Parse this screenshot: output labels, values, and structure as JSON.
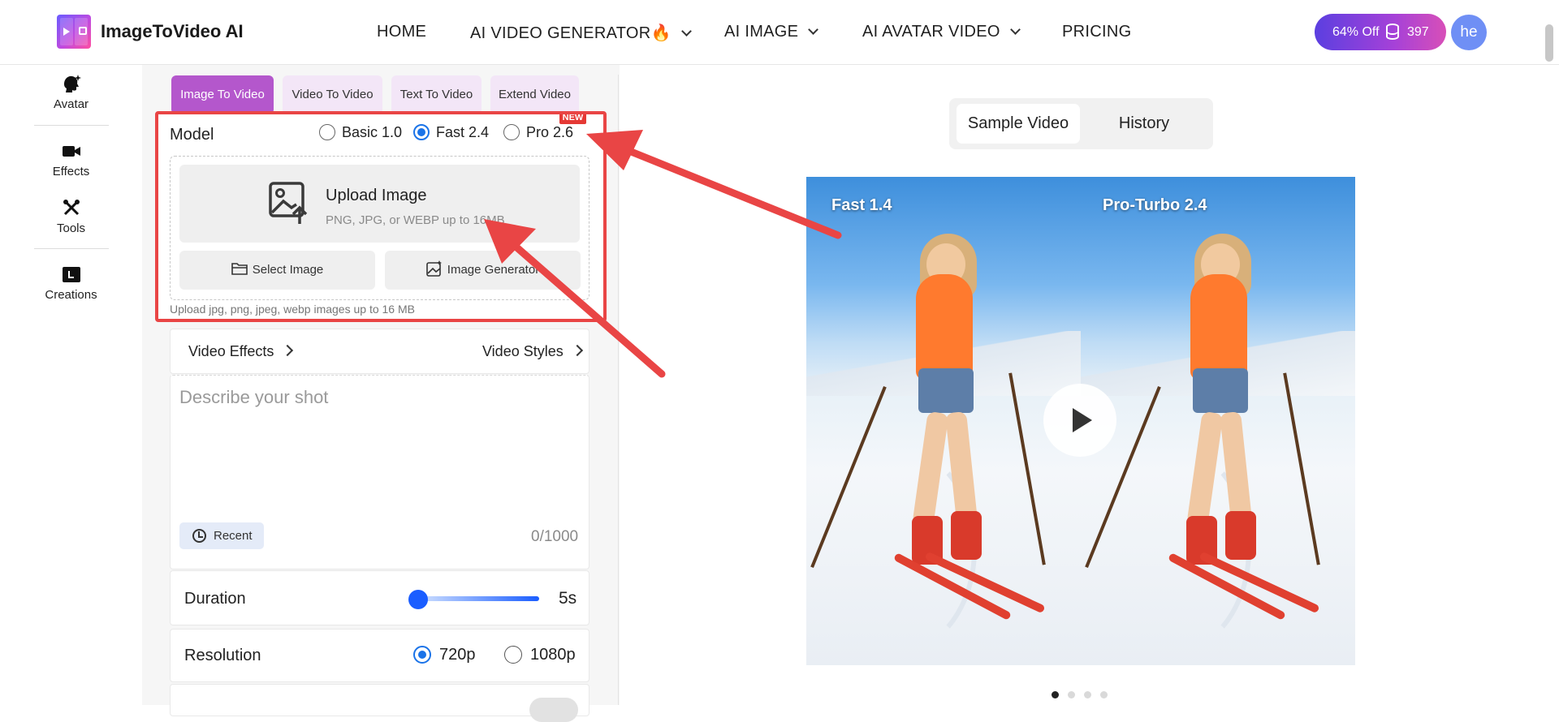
{
  "header": {
    "brand": "ImageToVideo AI",
    "nav": [
      {
        "label": "HOME"
      },
      {
        "label": "AI VIDEO GENERATOR🔥"
      },
      {
        "label": "AI IMAGE"
      },
      {
        "label": "AI AVATAR VIDEO"
      },
      {
        "label": "PRICING"
      }
    ],
    "promo_label": "64% Off",
    "credits": "397",
    "avatar_initials": "he"
  },
  "sidebar": {
    "items": [
      {
        "label": "Avatar",
        "icon": "avatar-icon"
      },
      {
        "label": "Effects",
        "icon": "video-camera-icon"
      },
      {
        "label": "Tools",
        "icon": "tools-icon"
      },
      {
        "label": "Creations",
        "icon": "creations-icon"
      }
    ]
  },
  "tabs": [
    {
      "label": "Image To Video",
      "active": true
    },
    {
      "label": "Video To Video"
    },
    {
      "label": "Text To Video"
    },
    {
      "label": "Extend Video"
    }
  ],
  "model": {
    "label": "Model",
    "options": [
      {
        "label": "Basic 1.0"
      },
      {
        "label": "Fast 2.4",
        "selected": true
      },
      {
        "label": "Pro 2.6"
      }
    ],
    "badge": "NEW"
  },
  "upload": {
    "title": "Upload Image",
    "subtitle": "PNG, JPG, or WEBP up to 16MB",
    "select_button": "Select Image",
    "generator_button": "Image Generator",
    "note": "Upload jpg, png, jpeg, webp images up to 16 MB"
  },
  "effects": {
    "left_label": "Video Effects",
    "right_label": "Video Styles"
  },
  "prompt": {
    "placeholder": "Describe your shot",
    "recent_label": "Recent",
    "counter": "0/1000"
  },
  "duration": {
    "label": "Duration",
    "value": "5s",
    "slider_fraction": 0
  },
  "resolution": {
    "label": "Resolution",
    "options": [
      {
        "label": "720p",
        "selected": true
      },
      {
        "label": "1080p"
      }
    ]
  },
  "preview": {
    "tabs": [
      {
        "label": "Sample Video",
        "active": true
      },
      {
        "label": "History"
      }
    ],
    "left_caption": "Fast 1.4",
    "right_caption": "Pro-Turbo 2.4",
    "carousel_index": 1,
    "carousel_count": 4
  },
  "colors": {
    "accent_purple": "#b457cc",
    "radio_blue": "#1a73e8",
    "annotation_red": "#e94545",
    "slider_blue": "#1a5dff"
  }
}
